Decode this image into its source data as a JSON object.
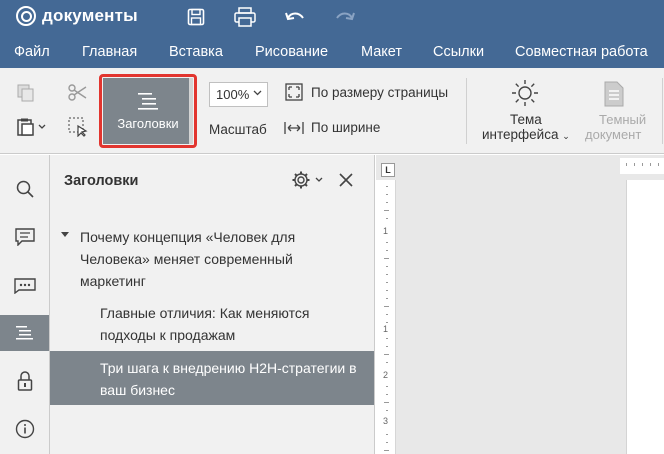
{
  "app": {
    "logo_text": "документы"
  },
  "menu": [
    "Файл",
    "Главная",
    "Вставка",
    "Рисование",
    "Макет",
    "Ссылки",
    "Совместная работа"
  ],
  "toolbar": {
    "headings_label": "Заголовки",
    "zoom_value": "100%",
    "zoom_label": "Масштаб",
    "fit_page_label": "По размеру страницы",
    "fit_width_label": "По ширине",
    "theme_label_1": "Тема",
    "theme_label_2": "интерфейса",
    "dark_doc_label_1": "Темный",
    "dark_doc_label_2": "документ"
  },
  "panel": {
    "title": "Заголовки",
    "headings": [
      {
        "level": 1,
        "text": "Почему концепция «Человек для Человека» меняет современный маркетинг",
        "expanded": true
      },
      {
        "level": 2,
        "text": "Главные отличия: Как меняются подходы к продажам"
      },
      {
        "level": 2,
        "text": "Три шага к внедрению H2H-стратегии в ваш бизнес",
        "selected": true
      }
    ]
  },
  "ruler": {
    "corner": "L",
    "numbers": [
      "1",
      "1",
      "2",
      "3"
    ]
  },
  "colors": {
    "header": "#446995",
    "selected": "#7d858c",
    "highlight": "#e2352f",
    "toolbar_bg": "#f1f1f1"
  },
  "icons": [
    "save-icon",
    "print-icon",
    "undo-icon",
    "redo-icon",
    "copy-icon",
    "paste-icon",
    "cut-icon",
    "select-all-icon",
    "headings-icon",
    "fit-page-icon",
    "fit-width-icon",
    "sun-icon",
    "dark-document-icon",
    "search-icon",
    "comment-icon",
    "chat-icon",
    "navigation-icon",
    "lock-icon",
    "info-icon",
    "gear-icon",
    "close-icon"
  ]
}
